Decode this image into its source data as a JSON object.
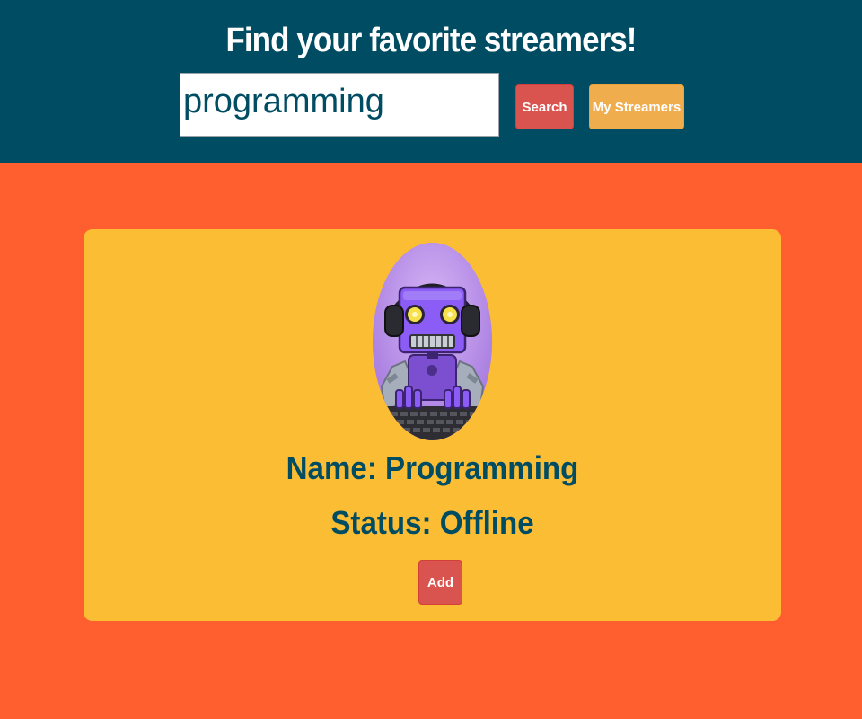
{
  "header": {
    "title": "Find your favorite streamers!",
    "search_value": "programming",
    "search_button": "Search",
    "my_streamers_button": "My Streamers"
  },
  "result": {
    "avatar_icon": "robot-gamer-icon",
    "name_text": "Name: Programming",
    "status_text": "Status: Offline",
    "add_button": "Add"
  },
  "colors": {
    "header_bg": "#004c63",
    "page_bg": "#ff5e2e",
    "card_bg": "#fbbd34",
    "search_button": "#d9534f",
    "my_streamers_button": "#f0ad4e",
    "text_dark": "#004c63"
  }
}
